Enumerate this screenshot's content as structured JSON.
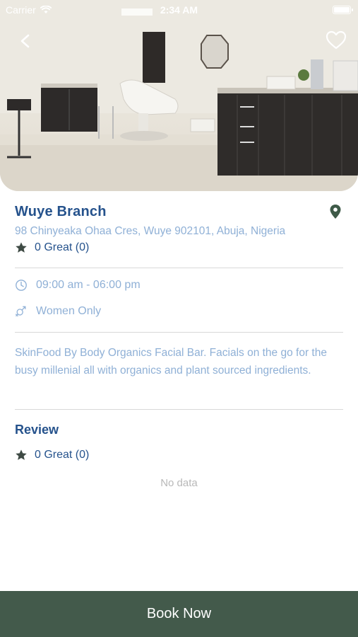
{
  "status_bar": {
    "carrier": "Carrier",
    "time": "2:34 AM"
  },
  "branch": {
    "name": "Wuye Branch",
    "address": "98 Chinyeaka Ohaa Cres, Wuye 902101, Abuja, Nigeria",
    "rating_text": "0 Great (0)",
    "hours": "09:00 am - 06:00 pm",
    "gender_policy": "Women Only",
    "description": "SkinFood By Body Organics Facial Bar. Facials on the go for the busy millenial all with organics and plant sourced ingredients."
  },
  "review": {
    "title": "Review",
    "rating_text": "0 Great (0)",
    "empty_text": "No data"
  },
  "actions": {
    "book_label": "Book Now"
  },
  "colors": {
    "primary_text": "#25528c",
    "secondary_text": "#8fb0d6",
    "accent_green": "#435a4b",
    "pin_green": "#3e5a48"
  },
  "icons": {
    "back": "chevron-left-icon",
    "favorite": "heart-outline-icon",
    "location": "map-pin-icon",
    "rating": "star-icon",
    "hours": "clock-icon",
    "gender": "gender-icon",
    "wifi": "wifi-icon",
    "battery": "battery-icon"
  }
}
